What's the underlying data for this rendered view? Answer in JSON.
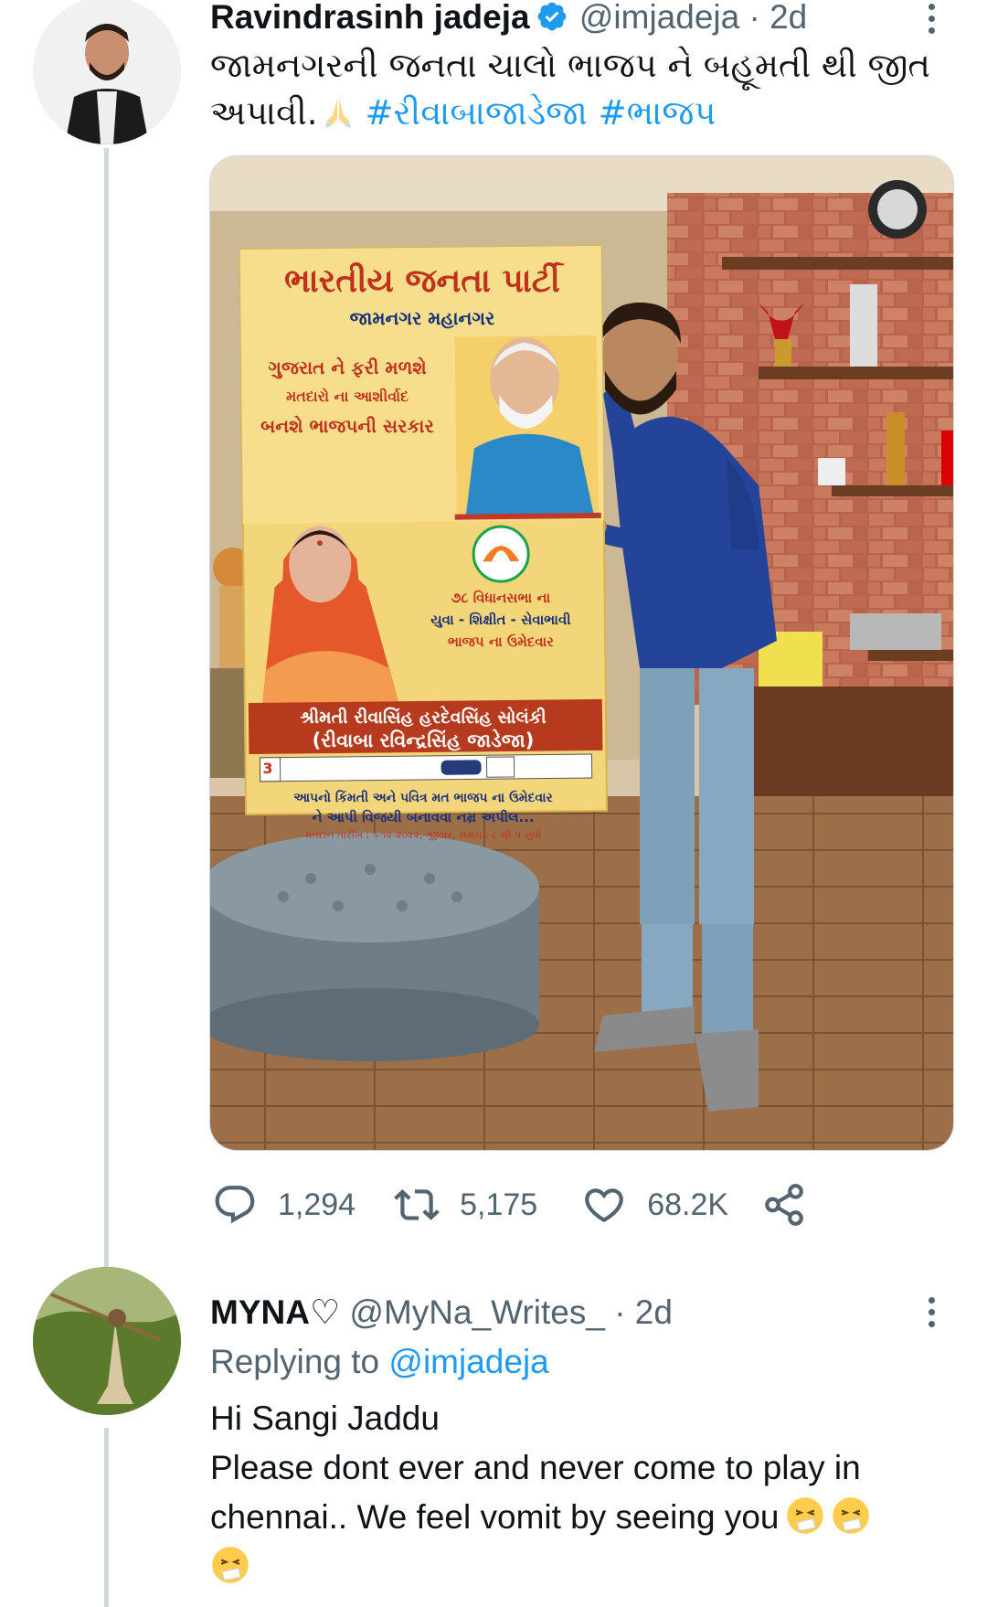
{
  "tweet1": {
    "author_name": "Ravindrasinh jadeja",
    "handle": "@imjadeja",
    "separator": "·",
    "time": "2d",
    "text_line1": "જામનગરની જનતા ચાલો ભાજપ ને બહૂમતી થી જીત",
    "text_line2": "અપાવી.",
    "hashtags": "#રીવાબાજાડેજા #ભાજપ",
    "poster": {
      "title": "ભારતીય જનતા પાર્ટી",
      "subtitle": "જામનગર મહાનગર",
      "slogan_1": "ગુજરાત ને ફરી મળશે",
      "slogan_2": "મતદારો ના આશીર્વાદ",
      "slogan_3": "બનશે ભાજપની સરકાર",
      "seat_1": "૭૮ વિધાનસભા ના",
      "seat_2": "યુવા - શિક્ષીત - સેવાભાવી",
      "seat_3": "ભાજપ ના ઉમેદવાર",
      "candidate_name": "શ્રીમતી રીવાસિંહ હરદેવસિંહ સોલંકી",
      "candidate_alias": "(રીવાબા રવિન્દ્રસિંહ જાડેજા)",
      "appeal_1": "આપનો કિંમતી અને પવિત્ર મત ભાજપ ના ઉમેદવાર",
      "ballot_no": "3",
      "appeal_2": "ને આપી વિજયી બનાવવા નમ્ર અપીલ...",
      "poll_date": "મતદાન તારીખ : ૧-૧૨-૨૦૨૨, ગુરૂવાર, સમય : ૮ થી ૫ સુધી"
    },
    "stats": {
      "replies": "1,294",
      "retweets": "5,175",
      "likes": "68.2K"
    }
  },
  "tweet2": {
    "author_name": "MYNA♡",
    "handle": "@MyNa_Writes_",
    "separator": "·",
    "time": "2d",
    "replying_label": "Replying to",
    "replying_handle": "@imjadeja",
    "text_line1": "Hi Sangi Jaddu",
    "text_line2": "Please dont ever and never come to play in",
    "text_line3": "chennai.. We feel vomit by seeing you"
  },
  "colors": {
    "accent": "#1d9bf0",
    "muted": "#536471",
    "text": "#0f1419",
    "thread_line": "#cfd9de"
  },
  "icons": [
    "verified-badge-icon",
    "more-icon",
    "reply-icon",
    "retweet-icon",
    "like-icon",
    "share-icon",
    "sneezing-face-emoji"
  ]
}
